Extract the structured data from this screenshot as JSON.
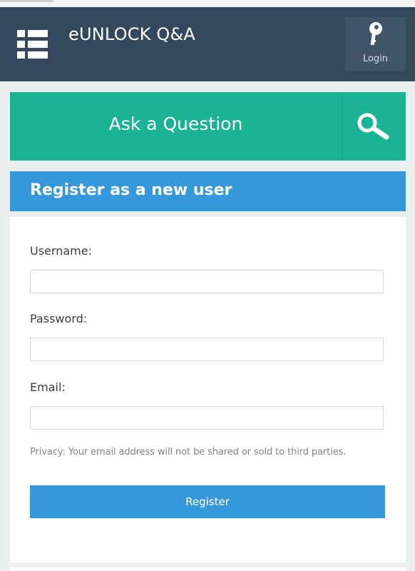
{
  "header": {
    "site_title": "eUNLOCK Q&A",
    "login_label": "Login",
    "menu_icon": "menu-list-icon",
    "login_icon": "key-icon",
    "background": "#34495e"
  },
  "ask": {
    "label": "Ask a Question",
    "search_icon": "search-icon",
    "color": "#1ab394"
  },
  "register": {
    "title": "Register as a new user",
    "username_label": "Username:",
    "username_value": "",
    "password_label": "Password:",
    "password_value": "",
    "email_label": "Email:",
    "email_value": "",
    "privacy_note": "Privacy: Your email address will not be shared or sold to third parties.",
    "submit_label": "Register",
    "color": "#3498db"
  }
}
